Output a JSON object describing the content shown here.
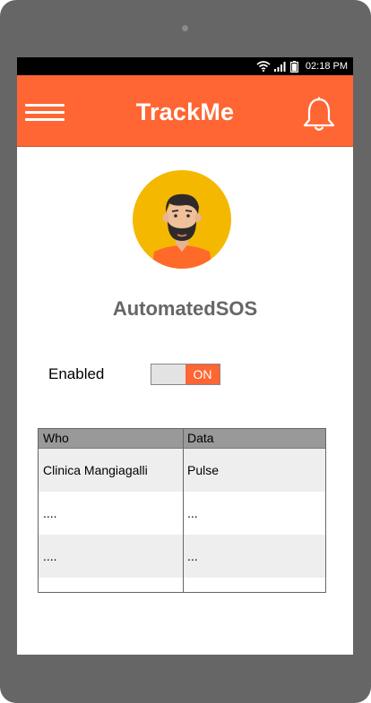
{
  "status_bar": {
    "time": "02:18 PM"
  },
  "app_bar": {
    "title": "TrackMe",
    "menu_icon": "hamburger-menu-icon",
    "notification_icon": "bell-icon"
  },
  "profile": {
    "name": "AutomatedSOS",
    "avatar_icon": "bearded-man-avatar"
  },
  "toggle": {
    "label": "Enabled",
    "state": "ON"
  },
  "table": {
    "headers": [
      "Who",
      "Data"
    ],
    "rows": [
      [
        "Clinica Mangiagalli",
        "Pulse"
      ],
      [
        "....",
        "..."
      ],
      [
        "....",
        "..."
      ],
      [
        "",
        ""
      ]
    ]
  },
  "colors": {
    "accent": "#ff6633",
    "device_frame": "#666666",
    "header_gray": "#999999",
    "row_shade": "#eeeeee"
  }
}
